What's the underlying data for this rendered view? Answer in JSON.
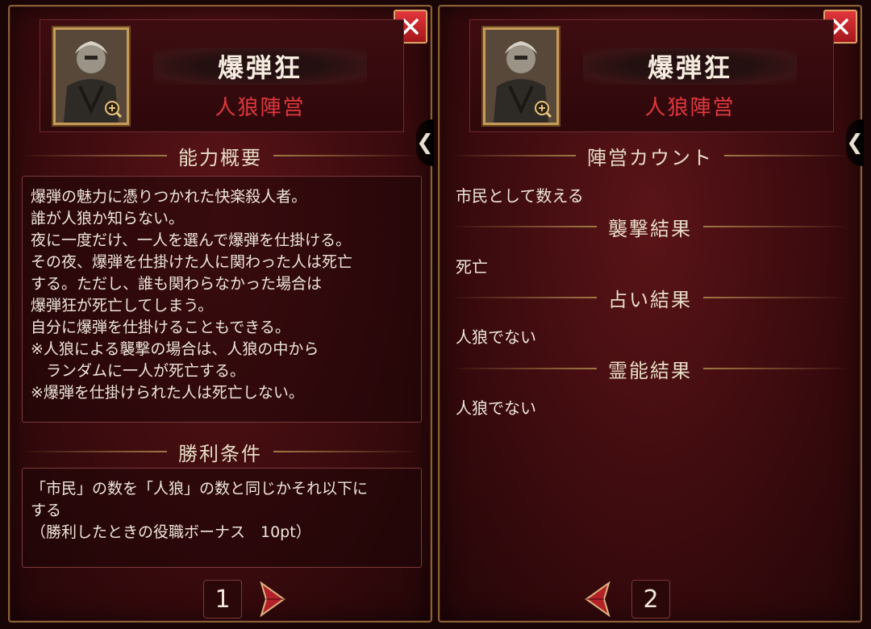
{
  "panels": [
    {
      "role_name": "爆弾狂",
      "faction": "人狼陣営",
      "ability_title": "能力概要",
      "ability_lines": [
        "爆弾の魅力に憑りつかれた快楽殺人者。",
        "誰が人狼か知らない。",
        "夜に一度だけ、一人を選んで爆弾を仕掛ける。",
        "その夜、爆弾を仕掛けた人に関わった人は死亡",
        "する。ただし、誰も関わらなかった場合は",
        "爆弾狂が死亡してしまう。",
        "自分に爆弾を仕掛けることもできる。",
        "※人狼による襲撃の場合は、人狼の中から",
        "　ランダムに一人が死亡する。",
        "※爆弾を仕掛けられた人は死亡しない。"
      ],
      "victory_title": "勝利条件",
      "victory_lines": [
        "「市民」の数を「人狼」の数と同じかそれ以下に",
        "する",
        "（勝利したときの役職ボーナス　10pt）"
      ],
      "page": "1"
    },
    {
      "role_name": "爆弾狂",
      "faction": "人狼陣営",
      "count_title": "陣営カウント",
      "count_value": "市民として数える",
      "attack_title": "襲撃結果",
      "attack_value": "死亡",
      "divination_title": "占い結果",
      "divination_value": "人狼でない",
      "medium_title": "霊能結果",
      "medium_value": "人狼でない",
      "page": "2"
    }
  ],
  "icons": {
    "close": "close-icon",
    "zoom": "zoom-plus-icon",
    "side_tab": "chevron-left-icon",
    "next": "next-arrow-icon",
    "prev": "prev-arrow-icon"
  },
  "colors": {
    "faction_red": "#e0383d",
    "close_red": "#c8252a",
    "gold": "#c79a58"
  }
}
